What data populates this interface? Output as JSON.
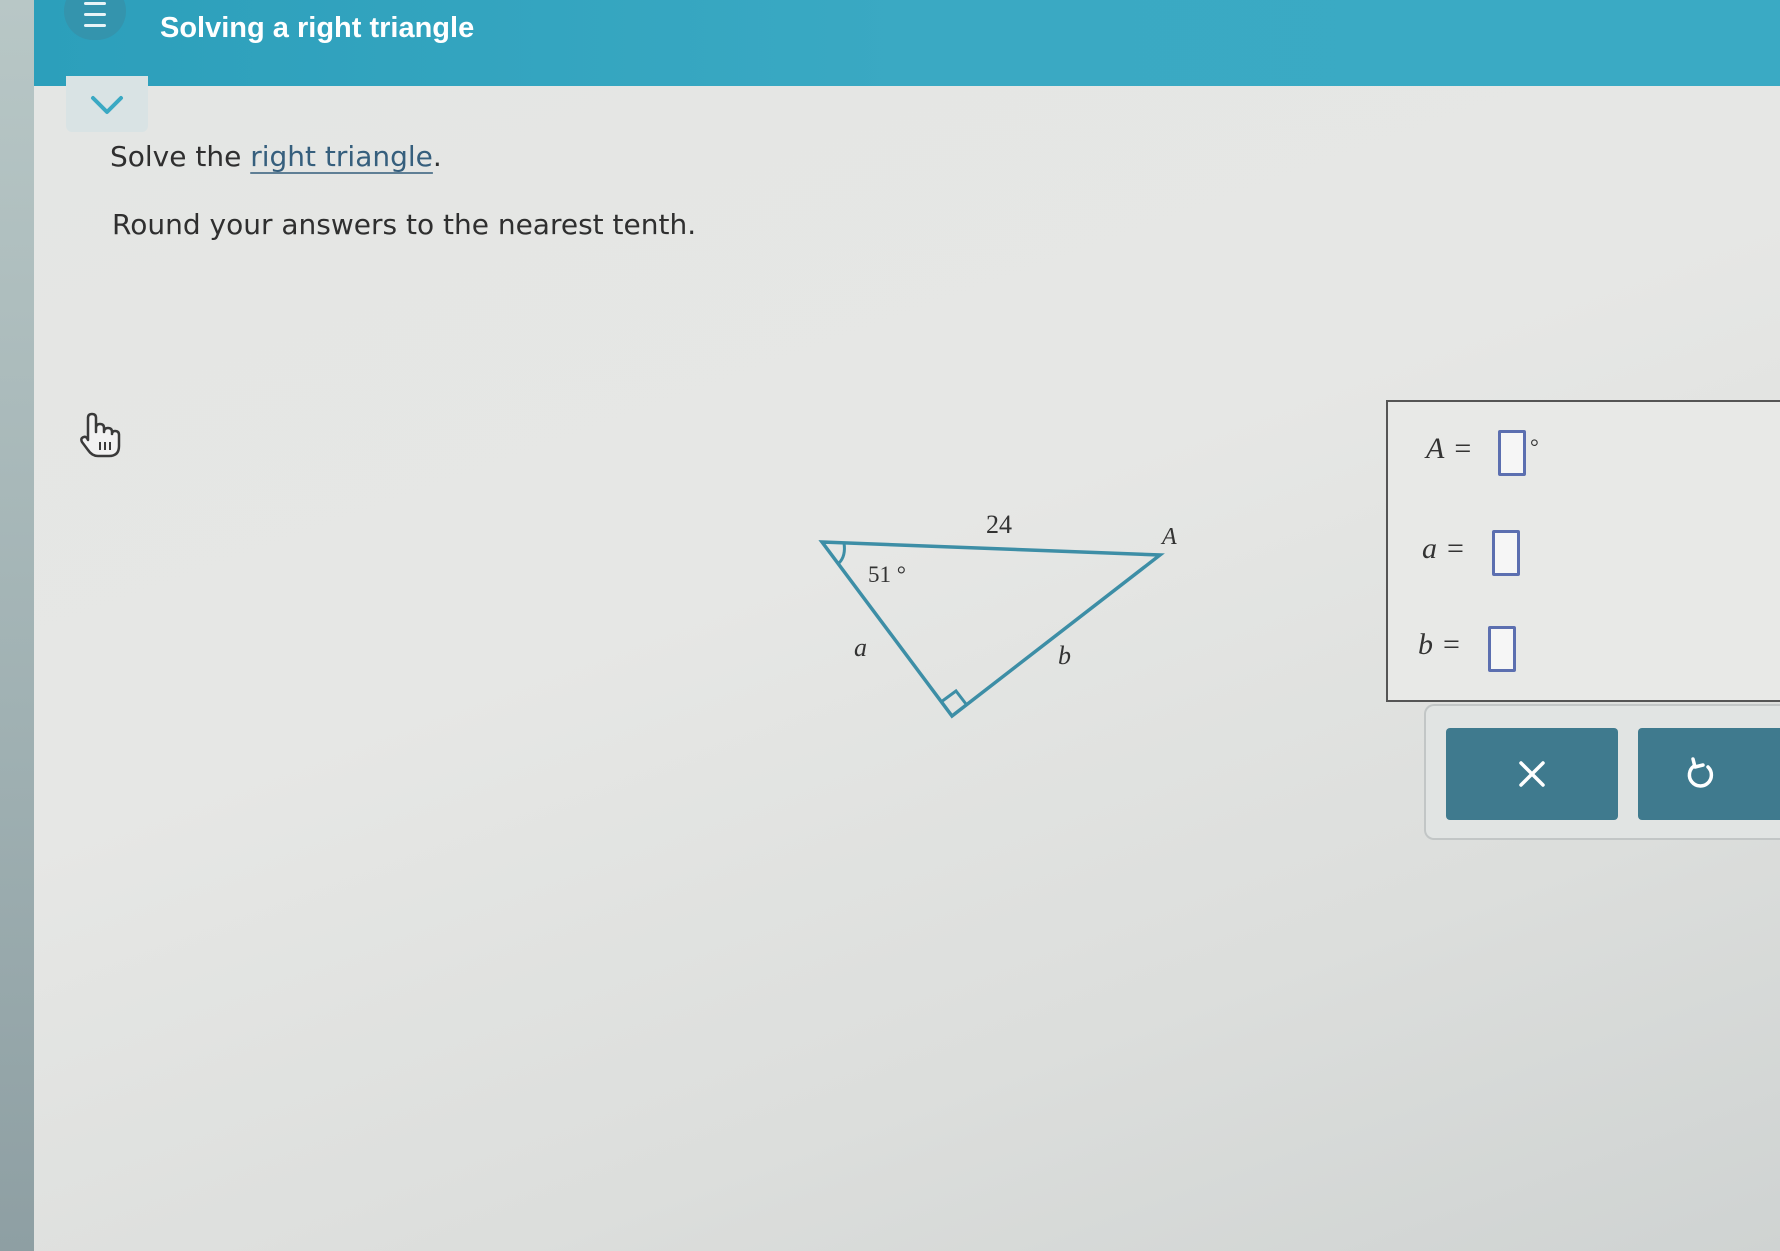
{
  "header": {
    "title": "Solving a right triangle"
  },
  "question": {
    "prefix": "Solve the ",
    "link": "right triangle",
    "suffix": ".",
    "instruction": "Round your answers to the nearest tenth."
  },
  "figure": {
    "hypotenuse_label": "24",
    "angle_label": "51 °",
    "vertex_label": "A",
    "side_a_label": "a",
    "side_b_label": "b"
  },
  "answers": {
    "A": {
      "var": "A",
      "equals": "=",
      "unit": "°",
      "value": ""
    },
    "a": {
      "var": "a",
      "equals": "=",
      "value": ""
    },
    "b": {
      "var": "b",
      "equals": "=",
      "value": ""
    }
  },
  "buttons": {
    "clear_icon": "x-icon",
    "undo_icon": "undo-icon"
  },
  "colors": {
    "header": "#3aa9c3",
    "triangle_stroke": "#3d8ea6",
    "button": "#3f7a8e",
    "input_border": "#5c6fb0"
  }
}
